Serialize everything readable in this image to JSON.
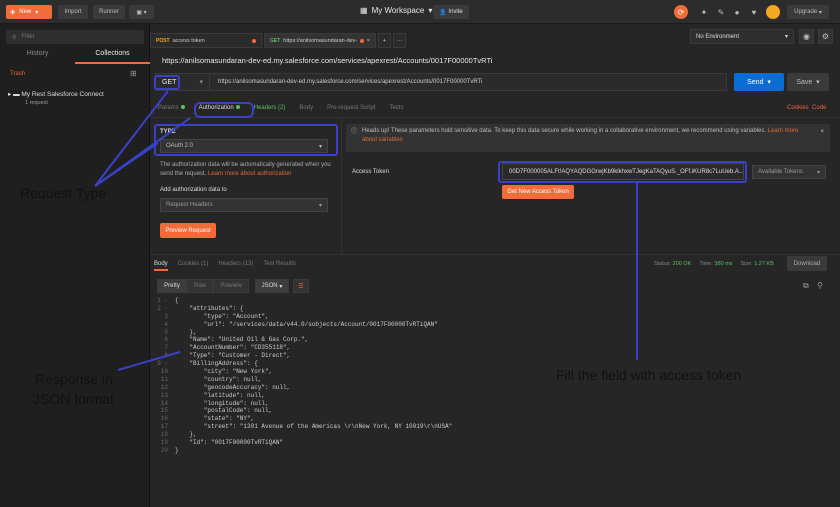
{
  "topbar": {
    "new_label": "New",
    "import_label": "Import",
    "runner_label": "Runner",
    "workspace_label": "My Workspace",
    "invite_label": "Invite",
    "upgrade_label": "Upgrade"
  },
  "sidebar": {
    "search_placeholder": "Filter",
    "tab_history": "History",
    "tab_collections": "Collections",
    "trash_label": "Trash",
    "collection_name": "My Rest Salesforce Connect",
    "collection_count": "1 request"
  },
  "tabs": [
    {
      "method": "POST",
      "title": "access token"
    },
    {
      "method": "GET",
      "title": "https://anilsomasundaran-dev-e"
    }
  ],
  "environment": "No Environment",
  "request": {
    "title": "https://anilsomasundaran-dev-ed.my.salesforce.com/services/apexrest/Accounts/0017F00000TvRTi",
    "method": "GET",
    "url": "https://anilsomasundaran-dev-ed.my.salesforce.com/services/apexrest/Accounts/0017F00000TvRTi",
    "send_label": "Send",
    "save_label": "Save"
  },
  "param_tabs": {
    "params": "Params",
    "authorization": "Authorization",
    "headers": "Headers (2)",
    "body": "Body",
    "prerequest": "Pre-request Script",
    "tests": "Tests",
    "cookies": "Cookies",
    "code": "Code"
  },
  "auth": {
    "type_label": "TYPE",
    "type_value": "OAuth 2.0",
    "info_text": "The authorization data will be automatically generated when you send the request.",
    "info_link": "Learn more about authorization",
    "add_label": "Add authorization data to",
    "add_value": "Request Headers",
    "preview_label": "Preview Request",
    "warning_text": "Heads up! These parameters hold sensitive data. To keep this data secure while working in a collaborative environment, we recommend using variables.",
    "warning_link": "Learn more about variables",
    "access_token_label": "Access Token",
    "access_token_value": "00D7F000005ALFt!AQYAQDGGrwjKb9klkhxwTJegKaTAQyuS._OFf.iKUR8c7LuUeb.A...",
    "available_tokens": "Available Tokens",
    "get_new_label": "Get New Access Token"
  },
  "response": {
    "tab_body": "Body",
    "tab_cookies": "Cookies (1)",
    "tab_headers": "Headers (13)",
    "tab_tests": "Test Results",
    "status_label": "Status:",
    "status_value": "200 OK",
    "time_label": "Time:",
    "time_value": "380 ms",
    "size_label": "Size:",
    "size_value": "1.27 KB",
    "download_label": "Download",
    "fmt_pretty": "Pretty",
    "fmt_raw": "Raw",
    "fmt_preview": "Preview",
    "fmt_json": "JSON",
    "lines": [
      "{",
      "    \"attributes\": {",
      "        \"type\": \"Account\",",
      "        \"url\": \"/services/data/v44.0/sobjects/Account/0017F00000TvRTiQAN\"",
      "    },",
      "    \"Name\": \"United Oil & Gas Corp.\",",
      "    \"AccountNumber\": \"CD355118\",",
      "    \"Type\": \"Customer - Direct\",",
      "    \"BillingAddress\": {",
      "        \"city\": \"New York\",",
      "        \"country\": null,",
      "        \"geocodeAccuracy\": null,",
      "        \"latitude\": null,",
      "        \"longitude\": null,",
      "        \"postalCode\": null,",
      "        \"state\": \"NY\",",
      "        \"street\": \"1301 Avenue of the Americas \\r\\nNew York, NY 10019\\r\\nUSA\"",
      "    },",
      "    \"Id\": \"0017F00000TvRTiQAN\"",
      "}"
    ]
  },
  "annotations": {
    "request_type": "Request Type",
    "response_json_line1": "Response in",
    "response_json_line2": "JSON format",
    "fill_token": "Fill the field with access token"
  },
  "colors": {
    "accent": "#f26b3a",
    "send": "#0c6cd5",
    "annotation": "#3941c9",
    "ok": "#5dbf62"
  }
}
